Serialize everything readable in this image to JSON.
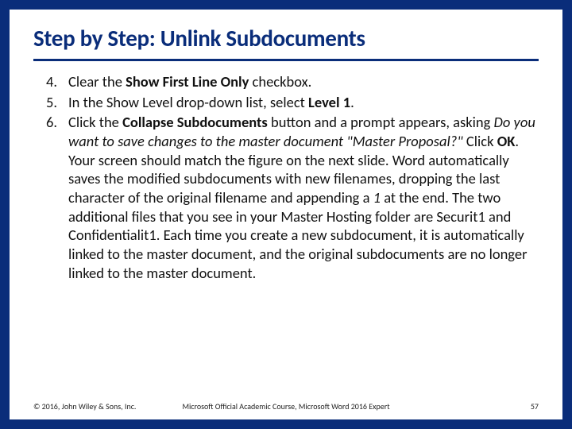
{
  "title": "Step by Step: Unlink Subdocuments",
  "items": [
    {
      "num": "4.",
      "segments": [
        {
          "t": "Clear the "
        },
        {
          "t": "Show First Line Only",
          "b": true
        },
        {
          "t": " checkbox."
        }
      ]
    },
    {
      "num": "5.",
      "segments": [
        {
          "t": "In the Show Level drop-down list, select "
        },
        {
          "t": "Level 1",
          "b": true
        },
        {
          "t": "."
        }
      ]
    },
    {
      "num": "6.",
      "segments": [
        {
          "t": "Click the "
        },
        {
          "t": "Collapse Subdocuments",
          "b": true
        },
        {
          "t": " button and a prompt appears, asking "
        },
        {
          "t": "Do you want to save changes to the master document \"Master Proposal?\"",
          "i": true
        },
        {
          "t": " Click "
        },
        {
          "t": "OK",
          "b": true
        },
        {
          "t": ". Your screen should match the figure on the next slide. Word automatically saves the modified subdocuments with new filenames, dropping the last character of the original filename and appending a "
        },
        {
          "t": "1",
          "i": true
        },
        {
          "t": " at the end. The two additional files that you see in your Master Hosting folder are Securit1 and Confidentialit1. Each time you create a new subdocument, it is automatically linked to the master document, and the original subdocuments are no longer linked to the master document."
        }
      ]
    }
  ],
  "footer": {
    "left": "© 2016, John Wiley & Sons, Inc.",
    "center": "Microsoft Official Academic Course, Microsoft Word 2016 Expert",
    "right": "57"
  }
}
